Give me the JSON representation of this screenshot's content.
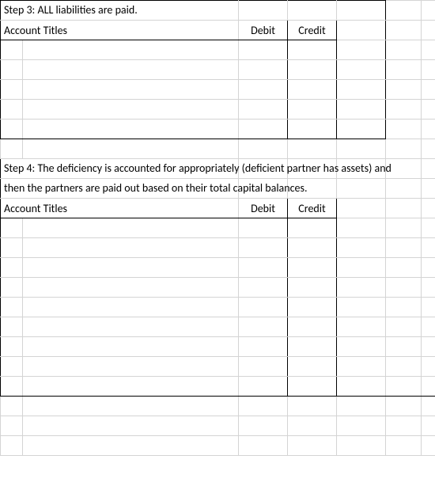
{
  "step3": {
    "title": "Step 3: ALL liabilities are paid.",
    "headers": {
      "account": "Account Titles",
      "debit": "Debit",
      "credit": "Credit"
    }
  },
  "step4": {
    "title_line1": "Step 4: The deficiency is accounted for appropriately (deficient partner has assets) and",
    "title_line2": "then the partners are paid out based on their total capital balances.",
    "headers": {
      "account": "Account Titles",
      "debit": "Debit",
      "credit": "Credit"
    }
  }
}
